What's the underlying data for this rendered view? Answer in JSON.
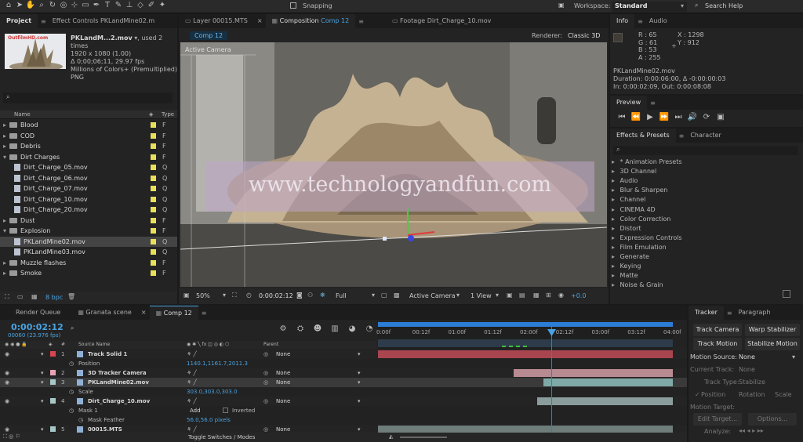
{
  "toolbar": {
    "snapping": "Snapping",
    "workspace_label": "Workspace:",
    "workspace_value": "Standard",
    "search_help": "Search Help"
  },
  "project": {
    "tab_project": "Project",
    "tab_effect_controls": "Effect Controls PKLandMine02.m",
    "file_name": "PKLandM...2.mov",
    "used": ", used 2 times",
    "res": "1920 x 1080 (1.00)",
    "duration": "Δ 0;00;06;11, 29.97 fps",
    "colors": "Millions of Colors+ (Premultiplied)",
    "codec": "PNG",
    "thumb_text": "OutfilmHD.com",
    "col_name": "Name",
    "col_type": "Type",
    "bpc": "8 bpc",
    "items": [
      {
        "label": "Blood",
        "level": 0,
        "kind": "folder",
        "expanded": false,
        "color": "#e8e05a",
        "type": "F"
      },
      {
        "label": "COD",
        "level": 0,
        "kind": "folder",
        "expanded": false,
        "color": "#e8e05a",
        "type": "F"
      },
      {
        "label": "Debris",
        "level": 0,
        "kind": "folder",
        "expanded": false,
        "color": "#e8e05a",
        "type": "F"
      },
      {
        "label": "Dirt Charges",
        "level": 0,
        "kind": "folder",
        "expanded": true,
        "color": "#e8e05a",
        "type": "F"
      },
      {
        "label": "Dirt_Charge_05.mov",
        "level": 1,
        "kind": "file",
        "color": "#e8e05a",
        "type": "Q"
      },
      {
        "label": "Dirt_Charge_06.mov",
        "level": 1,
        "kind": "file",
        "color": "#e8e05a",
        "type": "Q"
      },
      {
        "label": "Dirt_Charge_07.mov",
        "level": 1,
        "kind": "file",
        "color": "#e8e05a",
        "type": "Q"
      },
      {
        "label": "Dirt_Charge_10.mov",
        "level": 1,
        "kind": "file",
        "color": "#e8e05a",
        "type": "Q"
      },
      {
        "label": "Dirt_Charge_20.mov",
        "level": 1,
        "kind": "file",
        "color": "#e8e05a",
        "type": "Q"
      },
      {
        "label": "Dust",
        "level": 0,
        "kind": "folder",
        "expanded": false,
        "color": "#e8e05a",
        "type": "F"
      },
      {
        "label": "Explosion",
        "level": 0,
        "kind": "folder",
        "expanded": true,
        "color": "#e8e05a",
        "type": "F"
      },
      {
        "label": "PKLandMine02.mov",
        "level": 1,
        "kind": "file",
        "color": "#e8e05a",
        "type": "Q",
        "selected": true
      },
      {
        "label": "PKLandMine03.mov",
        "level": 1,
        "kind": "file",
        "color": "#e8e05a",
        "type": "Q"
      },
      {
        "label": "Muzzle flashes",
        "level": 0,
        "kind": "folder",
        "expanded": false,
        "color": "#e8e05a",
        "type": "F"
      },
      {
        "label": "Smoke",
        "level": 0,
        "kind": "folder",
        "expanded": false,
        "color": "#e8e05a",
        "type": "F"
      }
    ]
  },
  "viewer": {
    "tab_layer": "Layer 00015.MTS",
    "tab_comp_prefix": "Composition",
    "tab_comp_name": "Comp 12",
    "tab_footage": "Footage Dirt_Charge_10.mov",
    "comp_button": "Comp 12",
    "renderer_label": "Renderer:",
    "renderer_value": "Classic 3D",
    "active_camera": "Active Camera",
    "watermark": "www.technologyandfun.com",
    "zoom": "50%",
    "timecode": "0:00:02:12",
    "resolution": "Full",
    "camera": "Active Camera",
    "views": "1 View",
    "exposure": "+0.0"
  },
  "info": {
    "tab_info": "Info",
    "tab_audio": "Audio",
    "r": "R : 65",
    "g": "G : 61",
    "b": "B : 53",
    "a": "A : 255",
    "x": "X : 1298",
    "y": "Y : 912",
    "file": "PKLandMine02.mov",
    "duration": "Duration: 0:00:06:00, Δ -0:00:00:03",
    "inout": "In: 0:00:02:09, Out: 0:00:08:08"
  },
  "preview": {
    "title": "Preview"
  },
  "effects": {
    "tab": "Effects & Presets",
    "tab2": "Character",
    "items": [
      "* Animation Presets",
      "3D Channel",
      "Audio",
      "Blur & Sharpen",
      "Channel",
      "CINEMA 4D",
      "Color Correction",
      "Distort",
      "Expression Controls",
      "Film Emulation",
      "Generate",
      "Keying",
      "Matte",
      "Noise & Grain"
    ]
  },
  "timeline": {
    "tab_render": "Render Queue",
    "tab_granata": "Granata scene",
    "tab_comp": "Comp 12",
    "timecode": "0:00:02:12",
    "frames": "00060 (23.976 fps)",
    "col_hash": "#",
    "col_source": "Source Name",
    "col_parent": "Parent",
    "toggle": "Toggle Switches / Modes",
    "ruler": [
      "0:00f",
      "00:12f",
      "01:00f",
      "01:12f",
      "02:00f",
      "02:12f",
      "03:00f",
      "03:12f",
      "04:00f"
    ],
    "layers": [
      {
        "num": "1",
        "name": "Track Solid 1",
        "color": "#d8444f",
        "parent": "None",
        "prop": "Position",
        "prop_val": "1140.1,1161.7,2011.3",
        "bar": "#a8454f",
        "bar_start": 0,
        "bar_end": 1
      },
      {
        "num": "2",
        "name": "3D Tracker Camera",
        "color": "#e8a3b3",
        "parent": "None",
        "bar": "#b88a92",
        "bar_start": 0.46,
        "bar_end": 1
      },
      {
        "num": "3",
        "name": "PKLandMine02.mov",
        "color": "#a7c7c7",
        "parent": "None",
        "selected": true,
        "prop": "Scale",
        "prop_val": "303.0,303.0,303.0",
        "bar": "#7fa9a6",
        "bar_start": 0.56,
        "bar_end": 1
      },
      {
        "num": "4",
        "name": "Dirt_Charge_10.mov",
        "color": "#a7c7c7",
        "parent": "None",
        "prop": "Mask 1",
        "mask_mode": "Add",
        "mask_inverted": "Inverted",
        "prop2": "Mask Feather",
        "prop2_val": "56.0,56.0 pixels",
        "bar": "#8a9c9b",
        "bar_start": 0.54,
        "bar_end": 1
      },
      {
        "num": "5",
        "name": "00015.MTS",
        "color": "#a7c7c7",
        "parent": "None",
        "bar": "#6e7c7a",
        "bar_start": 0,
        "bar_end": 1
      }
    ]
  },
  "tracker": {
    "tab": "Tracker",
    "tab2": "Paragraph",
    "track_camera": "Track Camera",
    "warp": "Warp Stabilizer",
    "track_motion": "Track Motion",
    "stabilize": "Stabilize Motion",
    "motion_source_lbl": "Motion Source:",
    "motion_source": "None",
    "current_track_lbl": "Current Track:",
    "current_track": "None",
    "track_type_lbl": "Track Type:",
    "track_type": "Stabilize",
    "position": "Position",
    "rotation": "Rotation",
    "scale": "Scale",
    "motion_target": "Motion Target:",
    "edit_target": "Edit Target...",
    "options": "Options...",
    "analyze": "Analyze:"
  }
}
